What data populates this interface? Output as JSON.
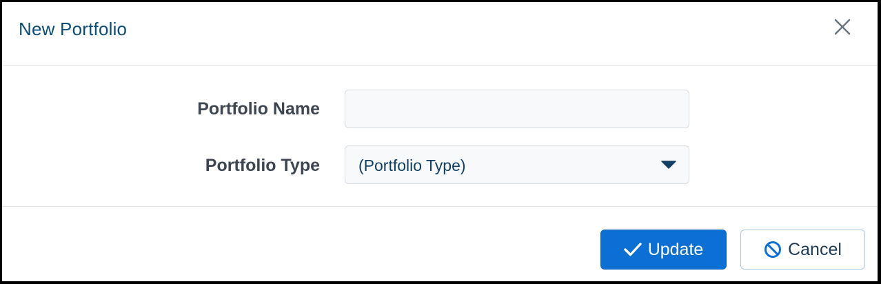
{
  "dialog": {
    "title": "New Portfolio",
    "close_icon": "close-icon"
  },
  "form": {
    "name_label": "Portfolio Name",
    "name_value": "",
    "name_placeholder": "",
    "type_label": "Portfolio Type",
    "type_selected": "(Portfolio Type)",
    "type_caret_icon": "caret-down-icon"
  },
  "footer": {
    "update_label": "Update",
    "update_icon": "checkmark-icon",
    "cancel_label": "Cancel",
    "cancel_icon": "ban-icon"
  },
  "colors": {
    "title": "#0b4d7a",
    "primary_button": "#0b6fd4",
    "cancel_border": "#a9c8e8",
    "label_text": "#3d4650"
  }
}
